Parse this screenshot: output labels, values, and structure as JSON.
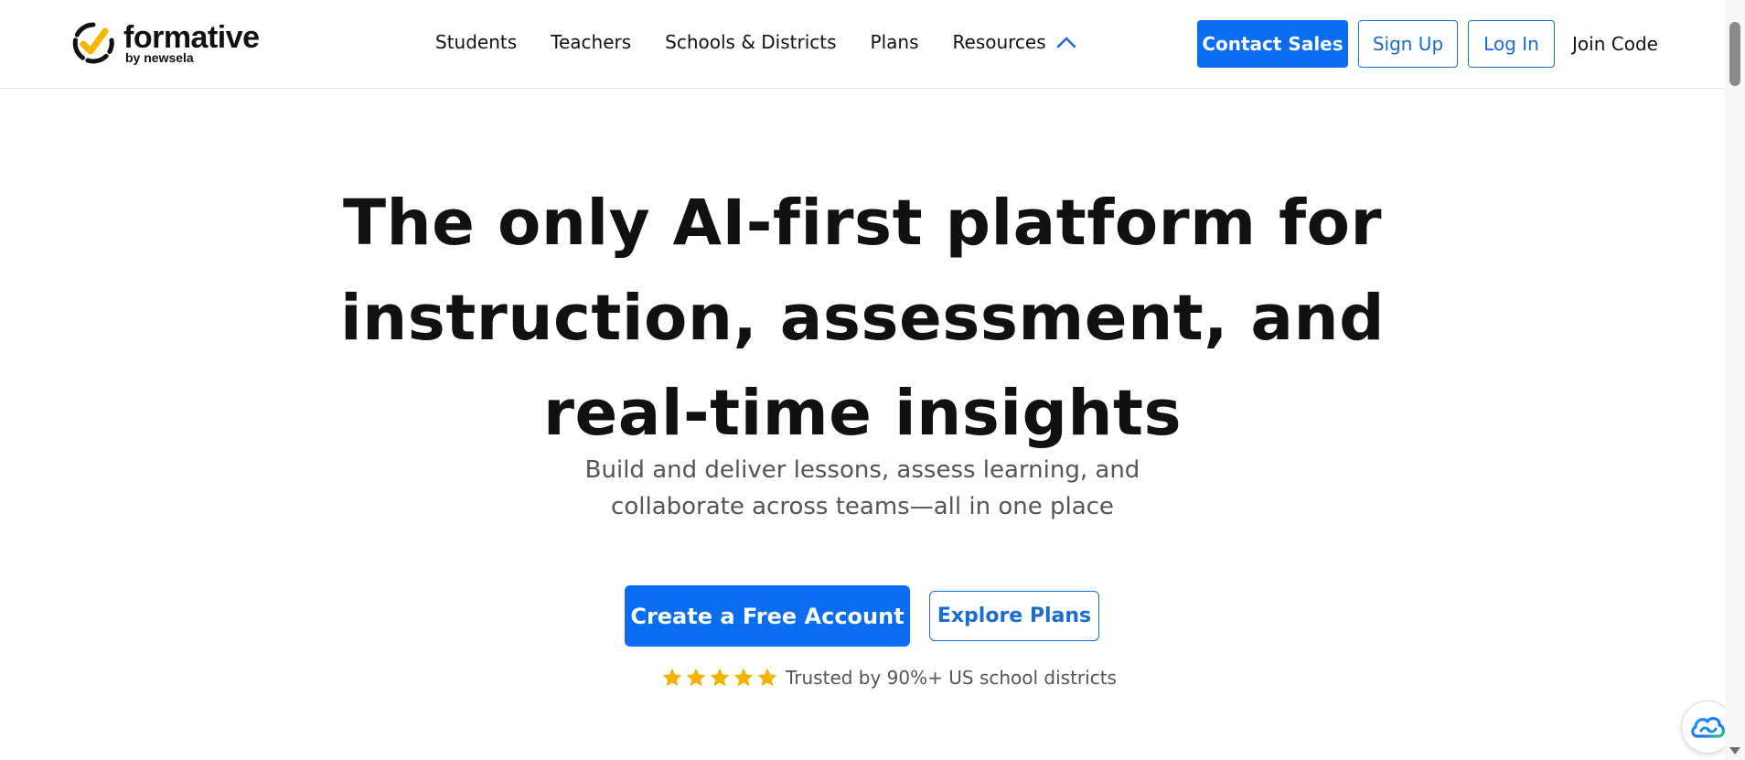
{
  "header": {
    "logo": {
      "name": "formative",
      "sub": "by newsela",
      "icon": "checkmark-circle-icon"
    },
    "nav": {
      "items": [
        {
          "label": "Students"
        },
        {
          "label": "Teachers"
        },
        {
          "label": "Schools & Districts"
        },
        {
          "label": "Plans"
        },
        {
          "label": "Resources",
          "icon": "chevron-up-icon"
        }
      ]
    },
    "buttons": {
      "contact_sales": "Contact Sales",
      "sign_up": "Sign Up",
      "log_in": "Log In",
      "join_code": "Join Code"
    }
  },
  "hero": {
    "title_lines": [
      "The only AI-first platform for",
      "instruction, assessment, and",
      "real-time insights"
    ],
    "subtitle_lines": [
      "Build and deliver lessons, assess learning, and",
      "collaborate across teams—all in one place"
    ],
    "cta_primary": "Create a Free Account",
    "cta_secondary": "Explore Plans",
    "trust": {
      "stars": 5,
      "text": "Trusted by 90%+ US school districts"
    }
  },
  "widget": {
    "icon": "cloud-assistant-icon"
  },
  "colors": {
    "accent": "#0a6cf0",
    "outline": "#1b6ccd",
    "star": "#f5b300",
    "logo_yellow": "#f7b500"
  }
}
